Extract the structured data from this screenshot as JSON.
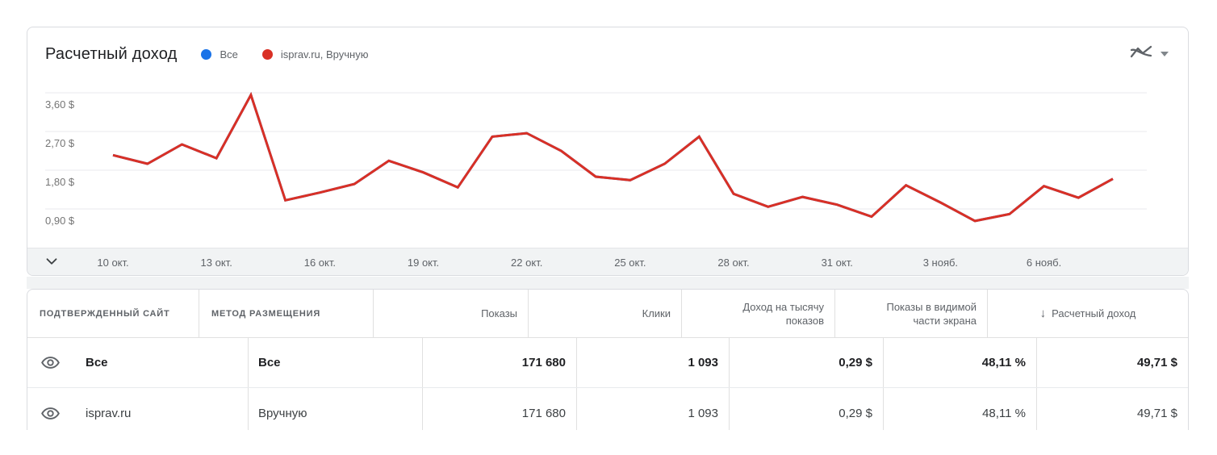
{
  "card": {
    "title": "Расчетный доход",
    "legend": [
      {
        "label": "Все",
        "color": "#1a73e8"
      },
      {
        "label": "isprav.ru, Вручную",
        "color": "#d93025"
      }
    ],
    "toolbar": {
      "chart_type_icon": "multiline-chart-icon",
      "dropdown_icon": "caret-down-icon"
    }
  },
  "chart_data": {
    "type": "line",
    "title": "Расчетный доход",
    "x_tick_labels": [
      "10 окт.",
      "13 окт.",
      "16 окт.",
      "19 окт.",
      "22 окт.",
      "25 окт.",
      "28 окт.",
      "31 окт.",
      "3 нояб.",
      "6 нояб."
    ],
    "x_tick_indices": [
      0,
      3,
      6,
      9,
      12,
      15,
      18,
      21,
      24,
      27
    ],
    "y_ticks": [
      0.9,
      1.8,
      2.7,
      3.6
    ],
    "y_tick_labels": [
      "0,90 $",
      "1,80 $",
      "2,70 $",
      "3,60 $"
    ],
    "ylim": [
      0,
      3.88
    ],
    "grid": true,
    "legend_position": "top",
    "currency": "$",
    "note": "blue series 'Все' is identical to red series and hidden beneath it",
    "series": [
      {
        "name": "Все",
        "color": "#1a73e8",
        "values": [
          2.15,
          1.95,
          2.4,
          2.08,
          3.55,
          1.1,
          1.28,
          1.48,
          2.02,
          1.75,
          1.4,
          2.58,
          2.66,
          2.25,
          1.65,
          1.57,
          1.95,
          2.58,
          1.25,
          0.95,
          1.18,
          1.0,
          0.72,
          1.45,
          1.05,
          0.62,
          0.78,
          1.43,
          1.16,
          1.6
        ]
      },
      {
        "name": "isprav.ru, Вручную",
        "color": "#d93025",
        "values": [
          2.15,
          1.95,
          2.4,
          2.08,
          3.55,
          1.1,
          1.28,
          1.48,
          2.02,
          1.75,
          1.4,
          2.58,
          2.66,
          2.25,
          1.65,
          1.57,
          1.95,
          2.58,
          1.25,
          0.95,
          1.18,
          1.0,
          0.72,
          1.45,
          1.05,
          0.62,
          0.78,
          1.43,
          1.16,
          1.6
        ]
      }
    ]
  },
  "table": {
    "columns": [
      {
        "label": "ПОДТВЕРЖДЕННЫЙ САЙТ"
      },
      {
        "label": "МЕТОД РАЗМЕЩЕНИЯ"
      },
      {
        "label": "Показы"
      },
      {
        "label": "Клики"
      },
      {
        "label": "Доход на тысячу показов"
      },
      {
        "label": "Показы в видимой части экрана"
      },
      {
        "label": "Расчетный доход",
        "sort": "desc",
        "sort_glyph": "↓"
      }
    ],
    "rows": [
      {
        "site": "Все",
        "method": "Все",
        "impressions": "171 680",
        "clicks": "1 093",
        "rpm": "0,29 $",
        "viewability": "48,11 %",
        "earnings": "49,71 $"
      },
      {
        "site": "isprav.ru",
        "method": "Вручную",
        "impressions": "171 680",
        "clicks": "1 093",
        "rpm": "0,29 $",
        "viewability": "48,11 %",
        "earnings": "49,71 $"
      }
    ]
  }
}
